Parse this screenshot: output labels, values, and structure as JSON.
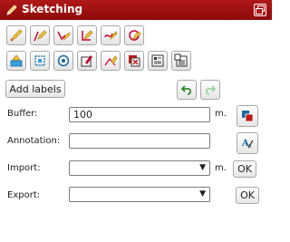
{
  "window": {
    "title": "Sketching",
    "title_icon": "pencil-icon",
    "restore_icon": "restore-window-icon"
  },
  "toolbar_row1": [
    {
      "name": "draw-point-icon"
    },
    {
      "name": "draw-line-icon"
    },
    {
      "name": "draw-polyline-icon"
    },
    {
      "name": "draw-polygon-icon"
    },
    {
      "name": "draw-freehand-icon"
    },
    {
      "name": "draw-circle-icon"
    }
  ],
  "toolbar_row2": [
    {
      "name": "add-text-icon"
    },
    {
      "name": "select-feature-icon"
    },
    {
      "name": "target-icon"
    },
    {
      "name": "edit-feature-icon"
    },
    {
      "name": "edit-vertices-icon"
    },
    {
      "name": "delete-feature-icon"
    },
    {
      "name": "properties-icon"
    },
    {
      "name": "clear-all-icon"
    }
  ],
  "actions": {
    "add_labels": "Add labels",
    "undo_icon": "undo-icon",
    "redo_icon": "redo-icon"
  },
  "form": {
    "buffer_label": "Buffer:",
    "buffer_value": "100",
    "buffer_unit": "m.",
    "annotation_label": "Annotation:",
    "annotation_value": "",
    "import_label": "Import:",
    "import_value": "",
    "import_unit": "m.",
    "import_ok": "OK",
    "export_label": "Export:",
    "export_value": "",
    "export_ok": "OK"
  },
  "side_icons": {
    "buffer_apply_icon": "buffer-apply-icon",
    "annotation_style_icon": "text-style-icon"
  }
}
